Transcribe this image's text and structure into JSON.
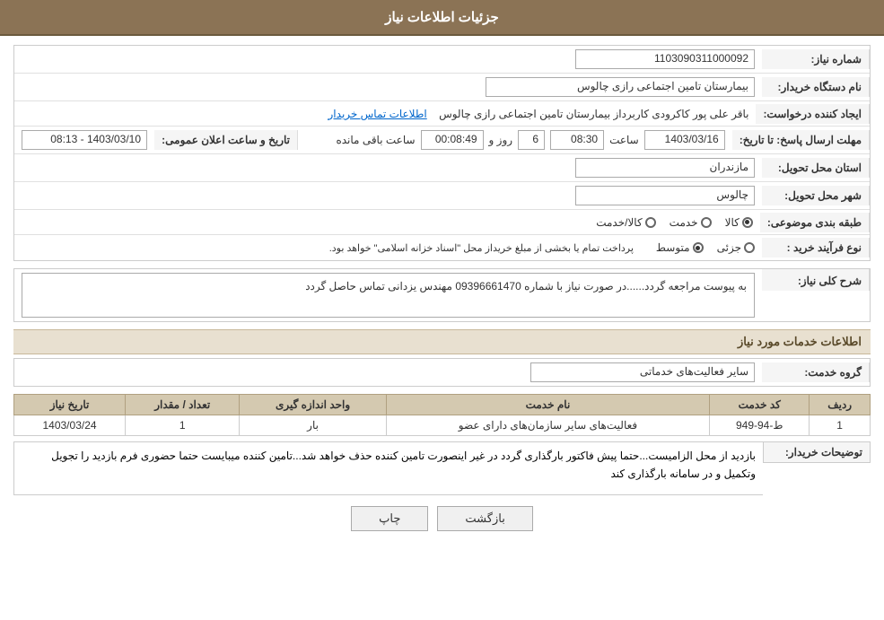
{
  "header": {
    "title": "جزئیات اطلاعات نیاز"
  },
  "fields": {
    "need_number_label": "شماره نیاز:",
    "need_number_value": "1103090311000092",
    "org_name_label": "نام دستگاه خریدار:",
    "org_name_value": "بیمارستان تامین اجتماعی رازی چالوس",
    "creator_label": "ایجاد کننده درخواست:",
    "creator_value": "باقر علی پور کاکرودی کاربرداز بیمارستان تامین اجتماعی رازی چالوس",
    "creator_link": "اطلاعات تماس خریدار",
    "deadline_label": "مهلت ارسال پاسخ: تا تاریخ:",
    "deadline_date": "1403/03/16",
    "deadline_time_label": "ساعت",
    "deadline_time": "08:30",
    "deadline_days_label": "روز و",
    "deadline_days": "6",
    "deadline_remaining_label": "ساعت باقی مانده",
    "deadline_remaining": "00:08:49",
    "announce_label": "تاریخ و ساعت اعلان عمومی:",
    "announce_value": "1403/03/10 - 08:13",
    "province_label": "استان محل تحویل:",
    "province_value": "مازندران",
    "city_label": "شهر محل تحویل:",
    "city_value": "چالوس",
    "category_label": "طبقه بندی موضوعی:",
    "category_kala": "کالا",
    "category_khedmat": "خدمت",
    "category_kala_khedmat": "کالا/خدمت",
    "category_selected": "کالا",
    "process_label": "نوع فرآیند خرید :",
    "process_jazei": "جزئی",
    "process_motavaset": "متوسط",
    "process_note": "پرداخت تمام یا بخشی از مبلغ خریداز محل \"اسناد خزانه اسلامی\" خواهد بود.",
    "description_label": "شرح کلی نیاز:",
    "description_value": "به پیوست مراجعه گردد......در صورت نیاز با شماره 09396661470 مهندس یزدانی تماس حاصل گردد",
    "service_info_title": "اطلاعات خدمات مورد نیاز",
    "service_group_label": "گروه خدمت:",
    "service_group_value": "سایر فعالیت‌های خدماتی",
    "table": {
      "headers": [
        "ردیف",
        "کد خدمت",
        "نام خدمت",
        "واحد اندازه گیری",
        "تعداد / مقدار",
        "تاریخ نیاز"
      ],
      "rows": [
        {
          "row_num": "1",
          "service_code": "ط-94-949",
          "service_name": "فعالیت‌های سایر سازمان‌های دارای عضو",
          "unit": "بار",
          "quantity": "1",
          "date": "1403/03/24"
        }
      ]
    },
    "buyer_notes_label": "توضیحات خریدار:",
    "buyer_notes_value": "بازدید از محل الزامیست...حتما پیش فاکتور بارگذاری گردد در غیر اینصورت تامین کننده حذف خواهد شد...تامین کننده میبایست حتما حضوری فرم بازدید را تجویل وتکمیل و در سامانه بارگذاری کند"
  },
  "buttons": {
    "back_label": "بازگشت",
    "print_label": "چاپ"
  }
}
